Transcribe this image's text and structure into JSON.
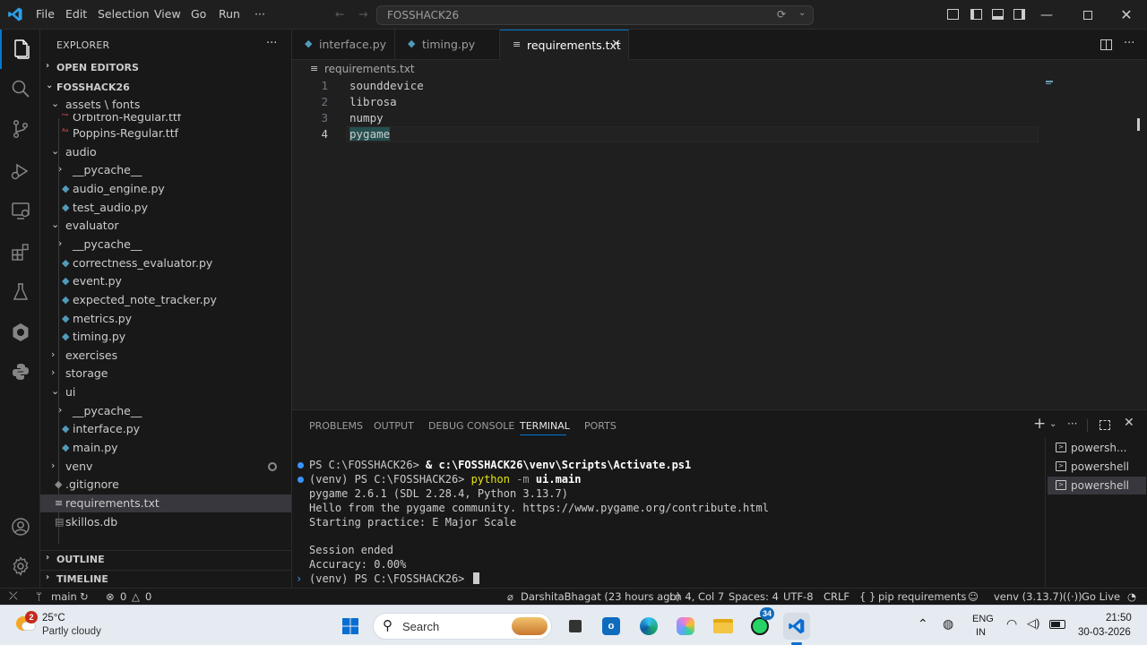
{
  "titlebar": {
    "menu": [
      "File",
      "Edit",
      "Selection",
      "View",
      "Go",
      "Run",
      "···"
    ],
    "search_text": "FOSSHACK26",
    "nav_back": "←",
    "nav_forward": "→"
  },
  "sidebar": {
    "header": "EXPLORER",
    "more": "···",
    "open_editors": "OPEN EDITORS",
    "root": "FOSSHACK26",
    "tree": [
      {
        "label": "assets \\ fonts",
        "type": "folder-open",
        "indent": 1
      },
      {
        "label": "Orbitron-Regular.ttf",
        "type": "font",
        "indent": 2
      },
      {
        "label": "Poppins-Regular.ttf",
        "type": "font",
        "indent": 2
      },
      {
        "label": "audio",
        "type": "folder-open",
        "indent": 1
      },
      {
        "label": "__pycache__",
        "type": "folder",
        "indent": 2
      },
      {
        "label": "audio_engine.py",
        "type": "py",
        "indent": 2
      },
      {
        "label": "test_audio.py",
        "type": "py",
        "indent": 2
      },
      {
        "label": "evaluator",
        "type": "folder-open",
        "indent": 1
      },
      {
        "label": "__pycache__",
        "type": "folder",
        "indent": 2
      },
      {
        "label": "correctness_evaluator.py",
        "type": "py",
        "indent": 2
      },
      {
        "label": "event.py",
        "type": "py",
        "indent": 2
      },
      {
        "label": "expected_note_tracker.py",
        "type": "py",
        "indent": 2
      },
      {
        "label": "metrics.py",
        "type": "py",
        "indent": 2
      },
      {
        "label": "timing.py",
        "type": "py",
        "indent": 2
      },
      {
        "label": "exercises",
        "type": "folder",
        "indent": 1
      },
      {
        "label": "storage",
        "type": "folder",
        "indent": 1
      },
      {
        "label": "ui",
        "type": "folder-open",
        "indent": 1
      },
      {
        "label": "__pycache__",
        "type": "folder",
        "indent": 2
      },
      {
        "label": "interface.py",
        "type": "py",
        "indent": 2
      },
      {
        "label": "main.py",
        "type": "py",
        "indent": 2
      },
      {
        "label": "venv",
        "type": "folder",
        "indent": 1
      },
      {
        "label": ".gitignore",
        "type": "git",
        "indent": 1
      },
      {
        "label": "requirements.txt",
        "type": "txt",
        "indent": 1,
        "selected": true
      },
      {
        "label": "skillos.db",
        "type": "db",
        "indent": 1
      }
    ],
    "outline": "OUTLINE",
    "timeline": "TIMELINE"
  },
  "tabs": [
    {
      "label": "interface.py"
    },
    {
      "label": "timing.py"
    },
    {
      "label": "requirements.txt",
      "active": true
    }
  ],
  "breadcrumb": "requirements.txt",
  "editor": {
    "lines": [
      {
        "num": "1",
        "text": "sounddevice"
      },
      {
        "num": "2",
        "text": "librosa"
      },
      {
        "num": "3",
        "text": "numpy"
      },
      {
        "num": "4",
        "text": "pygame"
      }
    ]
  },
  "panel": {
    "tabs": [
      "PROBLEMS",
      "OUTPUT",
      "DEBUG CONSOLE",
      "TERMINAL",
      "PORTS"
    ],
    "active_tab": "TERMINAL",
    "terminal": {
      "l1_prompt": "PS C:\\FOSSHACK26> ",
      "l1_cmd": "& c:\\FOSSHACK26\\venv\\Scripts\\Activate.ps1",
      "l2_prompt": "(venv) PS C:\\FOSSHACK26> ",
      "l2_cmd_a": "python",
      "l2_cmd_b": " -m ",
      "l2_cmd_c": "ui.main",
      "l3": "pygame 2.6.1 (SDL 2.28.4, Python 3.13.7)",
      "l4": "Hello from the pygame community. https://www.pygame.org/contribute.html",
      "l5": "Starting practice: E Major Scale",
      "l6": "Session ended",
      "l7": "Accuracy: 0.00%",
      "l8_prompt": "(venv) PS C:\\FOSSHACK26> "
    },
    "terminals": [
      "powersh...",
      "powershell",
      "powershell"
    ]
  },
  "statusbar": {
    "branch": "main",
    "errors": "0",
    "warnings": "0",
    "blame": "DarshitaBhagat (23 hours ago)",
    "position": "Ln 4, Col 7",
    "spaces": "Spaces: 4",
    "encoding": "UTF-8",
    "eol": "CRLF",
    "language": "pip requirements",
    "interpreter": "venv (3.13.7)",
    "golive": "Go Live"
  },
  "taskbar": {
    "weather_temp": "25°C",
    "weather_desc": "Partly cloudy",
    "weather_badge": "2",
    "search": "Search",
    "whatsapp_badge": "34",
    "lang_top": "ENG",
    "lang_bottom": "IN",
    "time": "21:50",
    "date": "30-03-2026"
  },
  "colors": {
    "accent": "#0078d4",
    "python_icon": "#519aba",
    "font_icon": "#e44d4d",
    "terminal_yellow": "#e5e510"
  }
}
